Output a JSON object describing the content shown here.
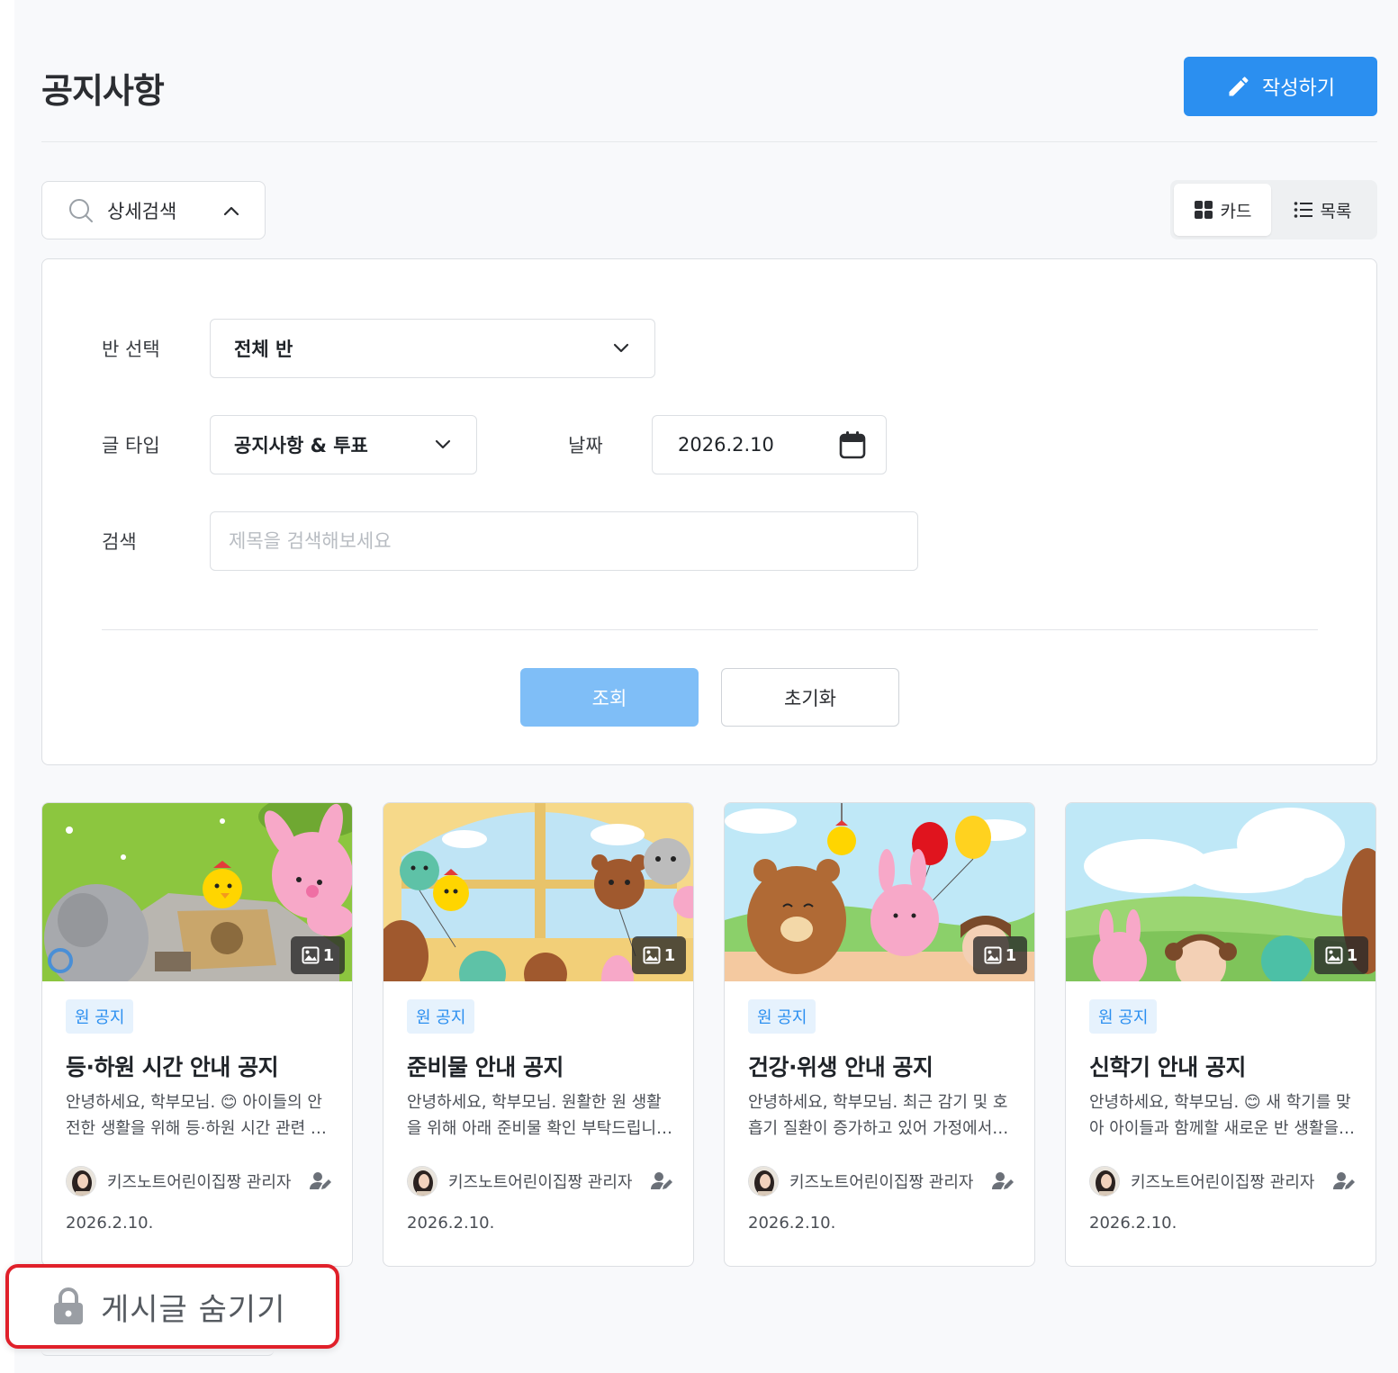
{
  "header": {
    "title": "공지사항",
    "write_label": "작성하기"
  },
  "search": {
    "toggle_label": "상세검색",
    "view_card_label": "카드",
    "view_list_label": "목록"
  },
  "filters": {
    "class_label": "반 선택",
    "class_value": "전체 반",
    "type_label": "글 타입",
    "type_value": "공지사항 & 투표",
    "date_label": "날짜",
    "date_value": "2026.2.10",
    "search_label": "검색",
    "search_placeholder": "제목을 검색해보세요",
    "query_label": "조회",
    "reset_label": "초기화"
  },
  "cards": [
    {
      "image_count": "1",
      "tag": "원 공지",
      "title": "등·하원 시간 안내 공지",
      "desc": "안녕하세요, 학부모님. 😊 아이들의 안전한 생활을 위해 등·하원 시간 관련 안내드립니다.",
      "author": "키즈노트어린이집짱 관리자",
      "date": "2026.2.10."
    },
    {
      "image_count": "1",
      "tag": "원 공지",
      "title": "준비물 안내 공지",
      "desc": "안녕하세요, 학부모님. 원활한 원 생활을 위해 아래 준비물 확인 부탁드립니다.",
      "author": "키즈노트어린이집짱 관리자",
      "date": "2026.2.10."
    },
    {
      "image_count": "1",
      "tag": "원 공지",
      "title": "건강·위생 안내 공지",
      "desc": "안녕하세요, 학부모님. 최근 감기 및 호흡기 질환이 증가하고 있어 가정에서도 관심 부탁드립니다.",
      "author": "키즈노트어린이집짱 관리자",
      "date": "2026.2.10."
    },
    {
      "image_count": "1",
      "tag": "원 공지",
      "title": "신학기 안내 공지",
      "desc": "안녕하세요, 학부모님. 😊 새 학기를 맞아 아이들과 함께할 새로운 반 생활을 안내드립니다.",
      "author": "키즈노트어린이집짱 관리자",
      "date": "2026.2.10."
    }
  ],
  "popup": {
    "hide_label": "게시글 숨기기"
  },
  "colors": {
    "primary": "#2b8ff0",
    "primary_light": "#7fbef7",
    "highlight": "#e0202a"
  },
  "icons": [
    "pencil-icon",
    "search-icon",
    "chevron-up-icon",
    "grid-icon",
    "list-icon",
    "chevron-down-icon",
    "calendar-icon",
    "image-icon",
    "user-edit-icon",
    "lock-icon"
  ]
}
